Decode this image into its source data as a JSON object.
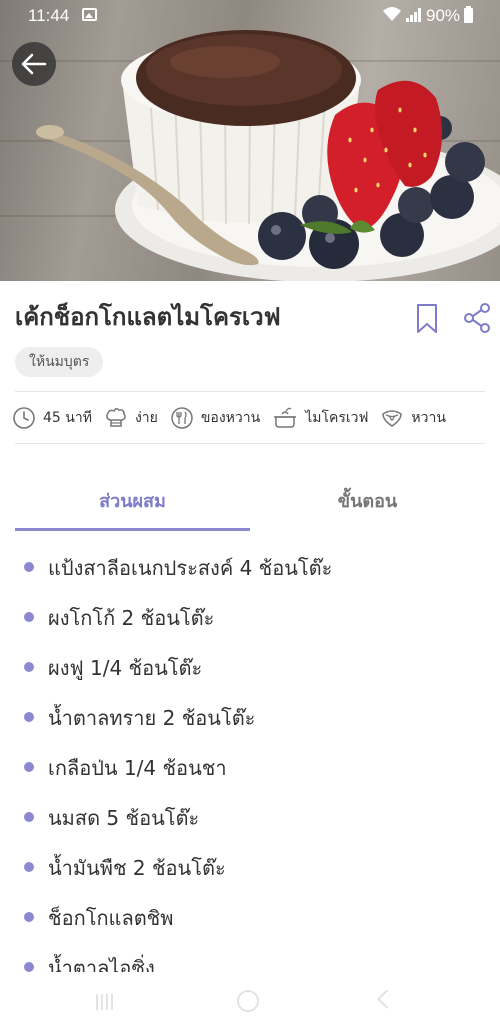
{
  "status_bar": {
    "time": "11:44",
    "battery": "90%"
  },
  "recipe": {
    "title": "เค้กช็อกโกแลตไมโครเวฟ",
    "tag": "ให้นมบุตร",
    "meta": [
      {
        "icon": "clock-icon",
        "label": "45 นาที"
      },
      {
        "icon": "chef-hat-icon",
        "label": "ง่าย"
      },
      {
        "icon": "plate-cutlery-icon",
        "label": "ของหวาน"
      },
      {
        "icon": "pot-icon",
        "label": "ไมโครเวฟ"
      },
      {
        "icon": "tongue-face-icon",
        "label": "หวาน"
      }
    ]
  },
  "tabs": {
    "ingredients": "ส่วนผสม",
    "steps": "ขั้นตอน"
  },
  "ingredients": [
    "แป้งสาลีอเนกประสงค์ 4 ช้อนโต๊ะ",
    "ผงโกโก้ 2 ช้อนโต๊ะ",
    "ผงฟู 1/4 ช้อนโต๊ะ",
    "น้ำตาลทราย 2 ช้อนโต๊ะ",
    "เกลือป่น 1/4 ช้อนชา",
    "นมสด 5 ช้อนโต๊ะ",
    "น้ำมันพืช 2 ช้อนโต๊ะ",
    "ช็อกโกแลตชิพ",
    "น้ำตาลไอซิ่ง"
  ],
  "colors": {
    "accent": "#8c89d0",
    "tab_active": "#7e7cc9",
    "tag_bg": "#eeeeee"
  }
}
